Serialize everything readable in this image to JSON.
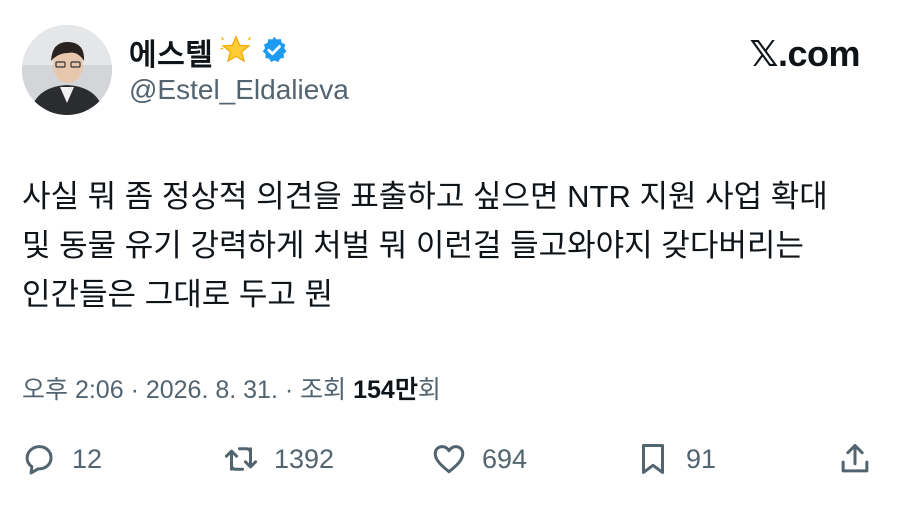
{
  "author": {
    "display_name": "에스텔",
    "handle": "@Estel_Eldalieva",
    "badge_emoji": "⭐",
    "verified_color": "#1d9bf0"
  },
  "source": {
    "site": "𝕏.com"
  },
  "tweet": {
    "lines": [
      "사실 뭐 좀 정상적 의견을 표출하고 싶으면 NTR 지원 사업 확대",
      "및 동물 유기 강력하게 처벌 뭐 이런걸 들고와야지 갖다버리는",
      "인간들은 그대로 두고 뭔"
    ]
  },
  "meta": {
    "time": "오후 2:06",
    "separator": "·",
    "date": "2026. 8. 31.",
    "views_label": "조회",
    "views_count": "154만",
    "views_suffix": "회"
  },
  "actions": {
    "replies": "12",
    "retweets": "1392",
    "likes": "694",
    "bookmarks": "91"
  }
}
